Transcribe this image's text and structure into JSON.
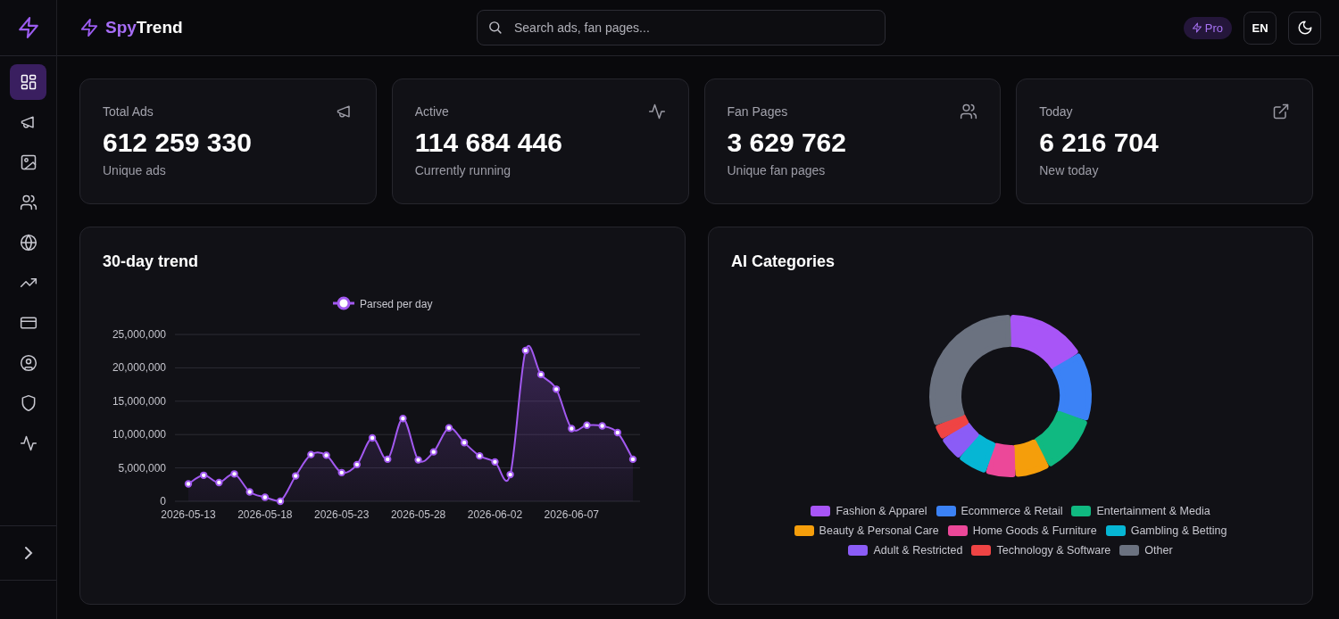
{
  "sidebar": {
    "items": [
      {
        "selected": true
      },
      {
        "selected": false
      },
      {
        "selected": false
      },
      {
        "selected": false
      },
      {
        "selected": false
      },
      {
        "selected": false
      },
      {
        "selected": false
      },
      {
        "selected": false
      },
      {
        "selected": false
      },
      {
        "selected": false
      }
    ]
  },
  "header": {
    "brand": {
      "accent": "Spy",
      "rest": "Trend"
    },
    "search": {
      "placeholder": "Search ads, fan pages..."
    },
    "plan_badge": "Pro",
    "language": "EN"
  },
  "stats": [
    {
      "label": "Total Ads",
      "value": "612 259 330",
      "caption": "Unique ads"
    },
    {
      "label": "Active",
      "value": "114 684 446",
      "caption": "Currently running"
    },
    {
      "label": "Fan Pages",
      "value": "3 629 762",
      "caption": "Unique fan pages"
    },
    {
      "label": "Today",
      "value": "6 216 704",
      "caption": "New today"
    }
  ],
  "trend": {
    "title": "30-day trend",
    "chart_data": {
      "type": "area",
      "categories": [
        "2026-05-13",
        null,
        null,
        null,
        null,
        "2026-05-18",
        null,
        null,
        null,
        null,
        "2026-05-23",
        null,
        null,
        null,
        null,
        "2026-05-28",
        null,
        null,
        null,
        null,
        "2026-06-02",
        null,
        null,
        null,
        null,
        "2026-06-07",
        null,
        null,
        null,
        null
      ],
      "series": [
        {
          "name": "Parsed per day",
          "color": "#a259f0",
          "values": [
            2600000,
            3900000,
            2800000,
            4100000,
            1400000,
            600000,
            0,
            3800000,
            7000000,
            6900000,
            4300000,
            5500000,
            9500000,
            6300000,
            12400000,
            6200000,
            7400000,
            11000000,
            8800000,
            6800000,
            5900000,
            4000000,
            22600000,
            19000000,
            16800000,
            10900000,
            11400000,
            11300000,
            10300000,
            6300000
          ]
        }
      ],
      "ylim": [
        0,
        25000000
      ],
      "grid": true,
      "yticks": [
        {
          "value": 0,
          "label": "0"
        },
        {
          "value": 5000000,
          "label": "5,000,000"
        },
        {
          "value": 10000000,
          "label": "10,000,000"
        },
        {
          "value": 15000000,
          "label": "15,000,000"
        },
        {
          "value": 20000000,
          "label": "20,000,000"
        },
        {
          "value": 25000000,
          "label": "25,000,000"
        }
      ]
    }
  },
  "categories": {
    "title": "AI Categories",
    "legend": [
      {
        "label": "Fashion & Apparel",
        "color": "#a855f7"
      },
      {
        "label": "Ecommerce & Retail",
        "color": "#3b82f6"
      },
      {
        "label": "Entertainment & Media",
        "color": "#10b981"
      },
      {
        "label": "Beauty & Personal Care",
        "color": "#f59e0b"
      },
      {
        "label": "Home Goods & Furniture",
        "color": "#ec4899"
      },
      {
        "label": "Gambling & Betting",
        "color": "#06b6d4"
      },
      {
        "label": "Adult & Restricted",
        "color": "#8b5cf6"
      },
      {
        "label": "Technology & Software",
        "color": "#ef4444"
      },
      {
        "label": "Other",
        "color": "#6b7280"
      }
    ]
  }
}
